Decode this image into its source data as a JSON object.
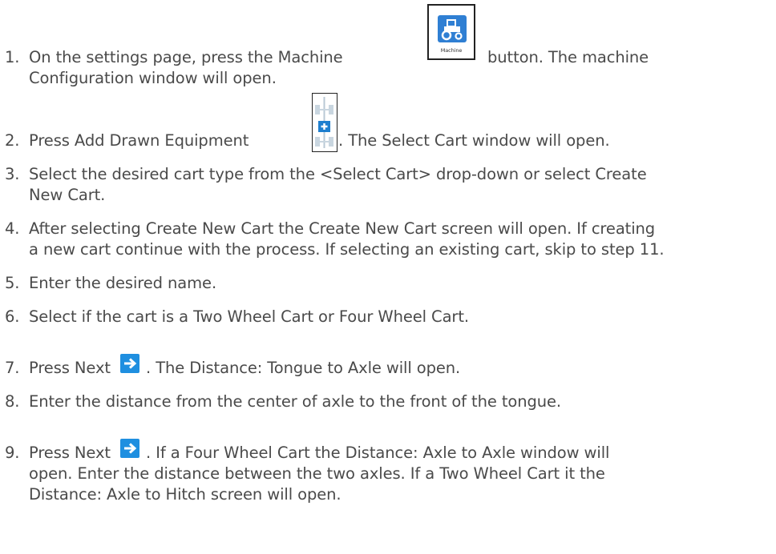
{
  "steps": [
    {
      "number": "1.",
      "lines": [
        "On the settings page, press the Machine",
        "button. The machine",
        "Configuration window will open."
      ],
      "icon": "machine-button-icon",
      "icon_caption": "Machine"
    },
    {
      "number": "2.",
      "lines": [
        "Press Add Drawn Equipment",
        ". The Select Cart window will open."
      ],
      "icon": "add-drawn-equipment-icon"
    },
    {
      "number": "3.",
      "lines": [
        "Select the desired cart type from the <Select Cart> drop-down or select Create",
        "New Cart."
      ]
    },
    {
      "number": "4.",
      "lines": [
        "After selecting Create New Cart the Create New Cart screen will open. If creating",
        "a new cart continue with the process. If selecting an existing cart, skip to step 11."
      ]
    },
    {
      "number": "5.",
      "lines": [
        "Enter the desired name."
      ]
    },
    {
      "number": "6.",
      "lines": [
        "Select if the cart is a Two Wheel Cart or Four Wheel Cart."
      ]
    },
    {
      "number": "7.",
      "lines": [
        "Press Next",
        ". The Distance: Tongue to Axle will open."
      ],
      "icon": "next-arrow-icon"
    },
    {
      "number": "8.",
      "lines": [
        "Enter the distance from the center of axle to the front of the tongue."
      ]
    },
    {
      "number": "9.",
      "lines": [
        "Press Next",
        ". If a Four Wheel Cart the Distance: Axle to Axle window will",
        "open. Enter the distance between the two axles. If a Two Wheel Cart it the",
        "Distance: Axle to Hitch screen will open."
      ],
      "icon": "next-arrow-icon"
    }
  ],
  "colors": {
    "text": "#4a4a4a",
    "icon_blue": "#2f7fd3",
    "next_blue": "#1f8fe0",
    "icon_border": "#222222"
  }
}
